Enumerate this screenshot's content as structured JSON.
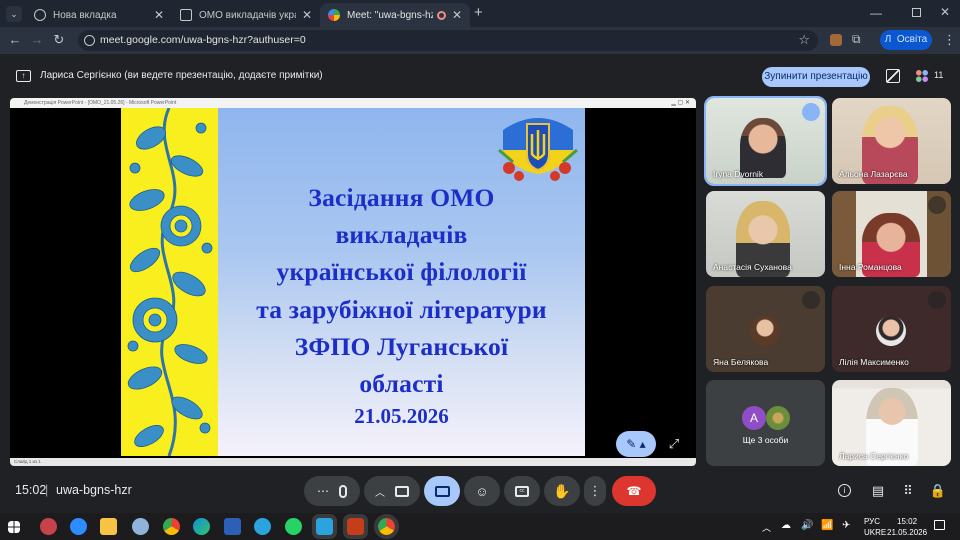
{
  "browser": {
    "tabs": [
      {
        "title": "Нова вкладка",
        "active": false
      },
      {
        "title": "ОМО викладачів української ф",
        "active": false
      },
      {
        "title": "Meet: \"uwa-bgns-hzr\"",
        "active": true
      }
    ],
    "url": "meet.google.com/uwa-bgns-hzr?authuser=0",
    "profile_initial": "Л",
    "profile_label": "Освіта"
  },
  "presenting": {
    "text": "Лариса Сергієнко (ви ведете презентацію, додаєте примітки)",
    "stop_label": "Зупинити презентацію",
    "participant_count": "11"
  },
  "powerpoint": {
    "title": "Демонстрація PowerPoint - [ОМО_21.05.26] - Microsoft PowerPoint",
    "status": "Слайд 1 из 1"
  },
  "slide": {
    "lines": [
      "Засідання ОМО",
      "викладачів",
      "української філології",
      "та зарубіжної літератури",
      "ЗФПО Луганської",
      "області"
    ],
    "date": "21.05.2026"
  },
  "participants": [
    {
      "name": "Iryna Dvornik",
      "speaking": true,
      "muted": false
    },
    {
      "name": "Альона Лазарєва",
      "muted": false
    },
    {
      "name": "Анастасія Суханова",
      "muted": false
    },
    {
      "name": "Інна Романцова",
      "muted": true
    },
    {
      "name": "Яна Белякова",
      "muted": true
    },
    {
      "name": "Лілія Максименко",
      "muted": true
    },
    {
      "name": "Ще 3 особи",
      "avatar_letter": "А"
    },
    {
      "name": "Лариса Сергієнко",
      "muted": false
    }
  ],
  "meeting": {
    "time": "15:02",
    "code": "uwa-bgns-hzr"
  },
  "taskbar": {
    "lang_top": "РУС",
    "lang_bottom": "UKRE",
    "time": "15:02",
    "date": "21.05.2026"
  },
  "colors": {
    "slide_text": "#1c2ec8",
    "ornament_yellow": "#f9ee1e",
    "ornament_blue": "#3a8fc7",
    "end_call": "#dc362e",
    "present_active": "#a8c7fa"
  }
}
